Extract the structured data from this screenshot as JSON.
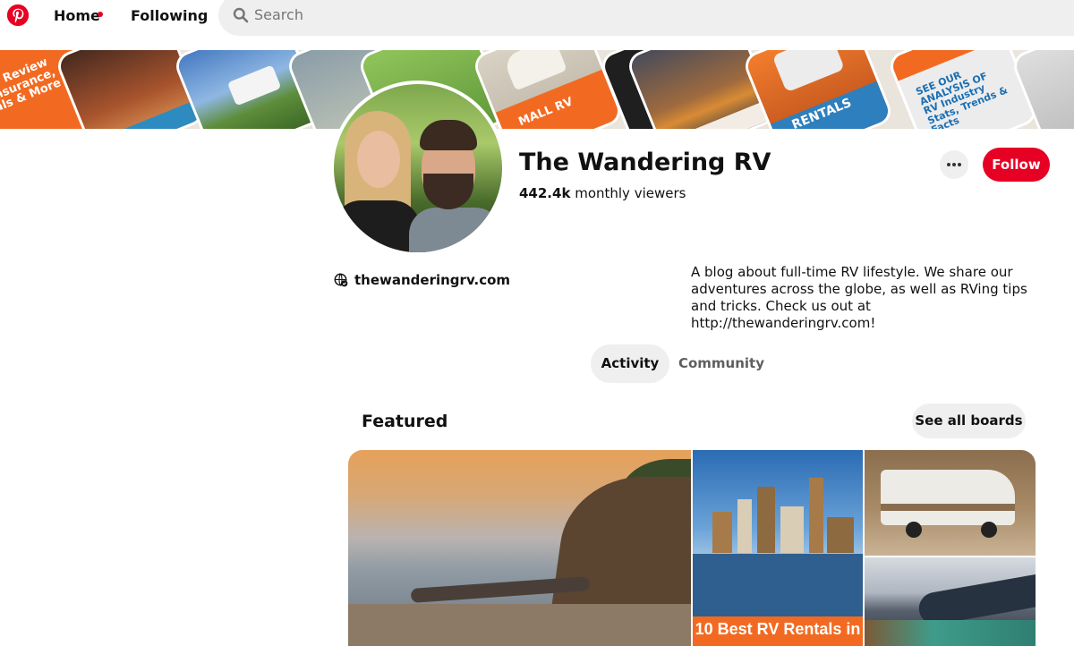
{
  "nav": {
    "home_label": "Home",
    "following_label": "Following",
    "search_placeholder": "Search",
    "brand_color": "#e60023"
  },
  "cover": {
    "tiles": [
      {
        "label": "sy Review\nInsurance,\nals & More"
      },
      {
        "label": "MALL RV"
      },
      {
        "label": "RENTALS"
      },
      {
        "label": "SEE OUR ANALYSIS OF RV Industry Stats, Trends & Facts"
      }
    ]
  },
  "profile": {
    "name": "The Wandering RV",
    "viewers_count": "442.4k",
    "viewers_label": "monthly viewers",
    "website": "thewanderingrv.com",
    "bio": "A blog about full-time RV lifestyle. We share our adventures across the globe, as well as RVing tips and tricks. Check us out at http://thewanderingrv.com!",
    "follow_label": "Follow"
  },
  "tabs": [
    {
      "label": "Activity",
      "active": true
    },
    {
      "label": "Community",
      "active": false
    }
  ],
  "featured": {
    "title": "Featured",
    "see_all_label": "See all boards",
    "city_banner": "10 Best RV Rentals in"
  },
  "icons": {
    "logo": "pinterest-logo-icon",
    "search": "search-icon",
    "more": "more-icon",
    "website": "verified-globe-icon"
  }
}
